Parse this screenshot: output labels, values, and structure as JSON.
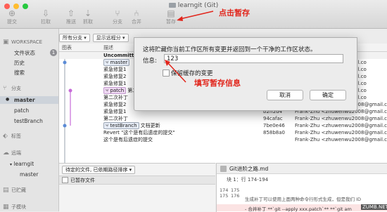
{
  "window": {
    "title": "learngit (Git)"
  },
  "toolbar": {
    "commit": "提交",
    "pull": "拉取",
    "push": "推送",
    "fetch": "抓取",
    "branch": "分支",
    "merge": "合并",
    "stash": "暂存"
  },
  "annotations": {
    "click_stash": "点击暂存",
    "fill_info": "填写暂存信息",
    "color": "#e1251b"
  },
  "sidebar": {
    "workspace": "WORKSPACE",
    "file_status": "文件状态",
    "file_status_count": "1",
    "history": "历史",
    "search": "搜索",
    "branches": "分支",
    "master": "master",
    "patch": "patch",
    "testBranch": "testBranch",
    "tags": "标签",
    "remotes": "远端",
    "remote_name": "learngit",
    "remote_master": "master",
    "stashes": "已贮藏",
    "submodules": "子模块"
  },
  "filter": {
    "branches": "所有分支",
    "remote": "显示远程分"
  },
  "columns": {
    "graph": "图表",
    "desc": "描述"
  },
  "commits": [
    {
      "desc": "Uncommitted",
      "hash": "",
      "author": ""
    },
    {
      "tags": [
        "master"
      ],
      "desc": "",
      "hash": "",
      "author": "@gmail.co"
    },
    {
      "desc": "紧急修复1",
      "hash": "",
      "author": "@gmail.co"
    },
    {
      "desc": "紧急修复2",
      "hash": "",
      "author": "@gmail.co"
    },
    {
      "desc": "紧急修复1",
      "hash": "",
      "author": "@gmail.co"
    },
    {
      "patch": "patch",
      "desc": "第二",
      "hash": "",
      "author": "@gmail.co"
    },
    {
      "desc": "第二次补丁",
      "hash": "",
      "author": "@gmail.co"
    },
    {
      "desc": "紧急修复2",
      "hash": "2c1ac6b",
      "author": "Frank-Zhu <zhuwenwu2008@gmail.co"
    },
    {
      "desc": "紧急修复1",
      "hash": "b2ff2d4",
      "author": "Frank-Zhu <zhuwenwu2008@gmail.co"
    },
    {
      "desc": "第二次补丁",
      "hash": "94cafac",
      "author": "Frank-Zhu <zhuwenwu2008@gmail.co"
    },
    {
      "tags": [
        "testBranch"
      ],
      "desc": "文档更新",
      "hash": "7be0e46",
      "author": "Frank-Zhu <zhuwenwu2008@gmail.co"
    },
    {
      "desc": "Revert \"这个是有后遗症的提交\"",
      "hash": "858b8a0",
      "author": "Frank-Zhu <zhuwenwu2008@gmail.co"
    },
    {
      "desc": "这个是有后遗症的提交",
      "hash": "",
      "author": "Frank-Zhu <zhuwenwu2008@gmail.co"
    }
  ],
  "bottom": {
    "sort": "待定的文件, 已依期路径排序",
    "staged": "已暂存文件"
  },
  "diff": {
    "file": "Git进阶之路.md",
    "hunk": "块 1：行 174-194",
    "ln1": "174",
    "ln2": "175",
    "ln3": "175",
    "ln4": "176",
    "line_ctx": "生成补丁可以使用上面两种命令行形式生成，但是我们 ID",
    "line_del": "- 合并补丁 **`git --apply xxx.patch`** **`git am",
    "watermark": "ZUMB.NET"
  },
  "dialog": {
    "message": "这将贮藏你当前工作区所有变更并返回到一个干净的工作区状态。",
    "info_label": "信息:",
    "info_value": "123",
    "keep_staged": "保留缓存的变更",
    "cancel": "取消",
    "ok": "确定"
  }
}
